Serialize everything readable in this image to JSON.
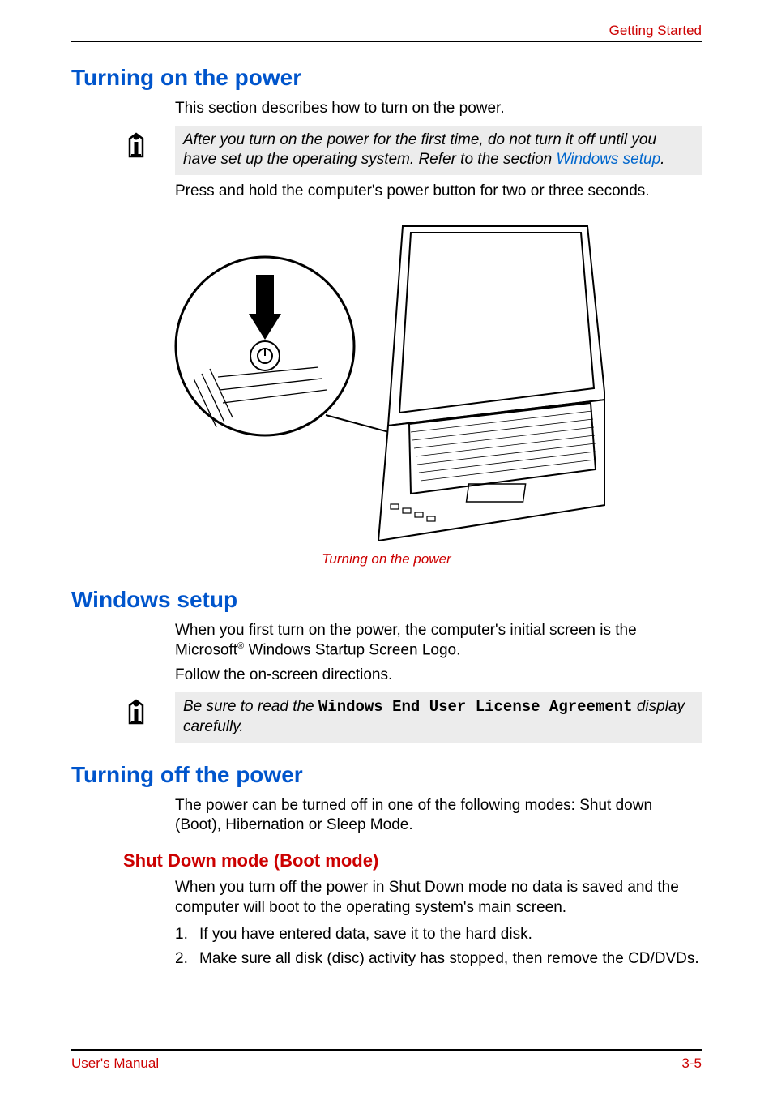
{
  "header": {
    "label": "Getting Started"
  },
  "sections": {
    "turn_on": {
      "heading": "Turning on the power",
      "intro": "This section describes how to turn on the power.",
      "note_pre": "After you turn on the power for the first time, do not turn it off until you have set up the operating system. Refer to the section ",
      "note_link": "Windows setup",
      "note_post": ".",
      "press": "Press and hold the computer's power button for two or three seconds.",
      "caption": "Turning on the power"
    },
    "win_setup": {
      "heading": "Windows setup",
      "p1_pre": "When you first turn on the power, the computer's initial screen is the Microsoft",
      "p1_sup": "®",
      "p1_post": " Windows Startup Screen Logo.",
      "p2": "Follow the on-screen directions.",
      "note_pre": "Be sure to read the ",
      "note_mono": "Windows End User License Agreement",
      "note_post": " display carefully."
    },
    "turn_off": {
      "heading": "Turning off the power",
      "intro": "The power can be turned off in one of the following modes: Shut down (Boot), Hibernation or Sleep Mode.",
      "shutdown": {
        "heading": "Shut Down mode (Boot mode)",
        "intro": "When you turn off the power in Shut Down mode no data is saved and the computer will boot to the operating system's main screen.",
        "items": [
          {
            "n": "1.",
            "t": "If you have entered data, save it to the hard disk."
          },
          {
            "n": "2.",
            "t": "Make sure all disk (disc) activity has stopped, then remove the CD/DVDs."
          }
        ]
      }
    }
  },
  "footer": {
    "left": "User's Manual",
    "right": "3-5"
  }
}
